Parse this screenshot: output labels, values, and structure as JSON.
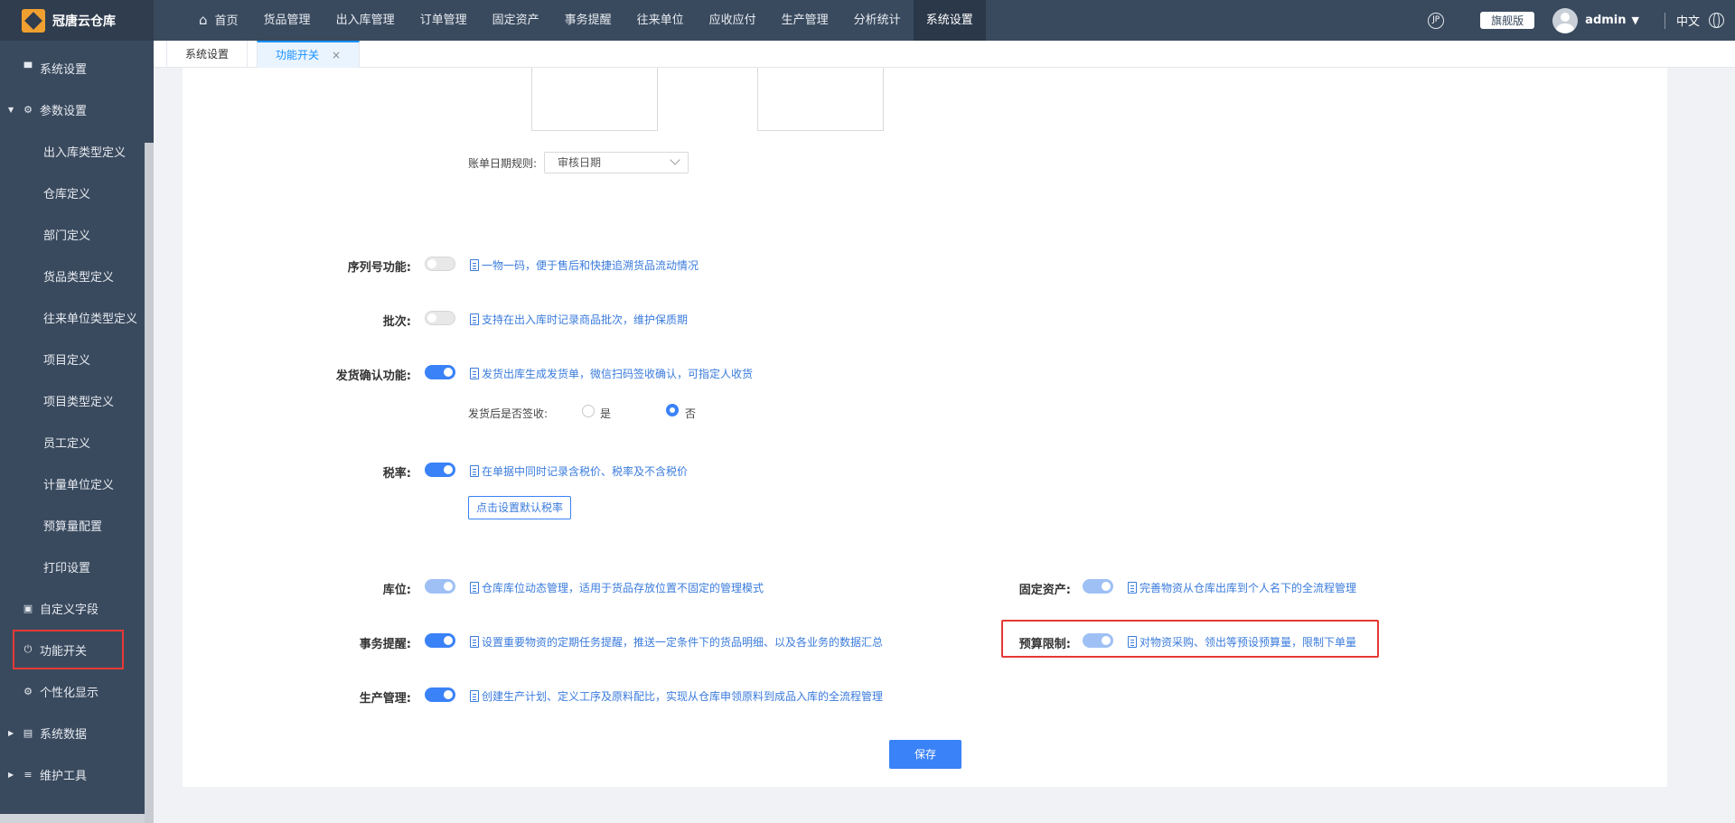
{
  "app": {
    "logo_text": "冠唐云仓库"
  },
  "nav": [
    {
      "label": "首页"
    },
    {
      "label": "货品管理"
    },
    {
      "label": "出入库管理"
    },
    {
      "label": "订单管理"
    },
    {
      "label": "固定资产"
    },
    {
      "label": "事务提醒"
    },
    {
      "label": "往来单位"
    },
    {
      "label": "应收应付"
    },
    {
      "label": "生产管理"
    },
    {
      "label": "分析统计"
    },
    {
      "label": "系统设置",
      "active": true
    }
  ],
  "topright": {
    "icon_text": "JP",
    "edition": "旗舰版",
    "user": "admin",
    "lang": "中文"
  },
  "sidebar": {
    "items": [
      {
        "label": "系统设置",
        "icon": "monitor-icon"
      },
      {
        "label": "参数设置",
        "icon": "gear-icon",
        "expanded": true
      },
      {
        "label": "出入库类型定义"
      },
      {
        "label": "仓库定义"
      },
      {
        "label": "部门定义"
      },
      {
        "label": "货品类型定义"
      },
      {
        "label": "往来单位类型定义"
      },
      {
        "label": "项目定义"
      },
      {
        "label": "项目类型定义"
      },
      {
        "label": "员工定义"
      },
      {
        "label": "计量单位定义"
      },
      {
        "label": "预算量配置"
      },
      {
        "label": "打印设置"
      },
      {
        "label": "自定义字段",
        "icon": "form-icon"
      },
      {
        "label": "功能开关",
        "icon": "power-icon",
        "selected": true
      },
      {
        "label": "个性化显示",
        "icon": "gear-icon"
      },
      {
        "label": "系统数据",
        "icon": "chart-icon"
      },
      {
        "label": "维护工具",
        "icon": "database-icon"
      }
    ]
  },
  "tabs": [
    {
      "label": "系统设置"
    },
    {
      "label": "功能开关",
      "active": true,
      "close": "×"
    }
  ],
  "bill_date": {
    "label": "账单日期规则:",
    "value": "审核日期"
  },
  "features": {
    "serial": {
      "label": "序列号功能:",
      "on": false,
      "desc": "一物一码，便于售后和快捷追溯货品流动情况"
    },
    "batch": {
      "label": "批次:",
      "on": false,
      "desc": "支持在出入库时记录商品批次，维护保质期"
    },
    "delivery": {
      "label": "发货确认功能:",
      "on": true,
      "desc": "发货出库生成发货单，微信扫码签收确认，可指定人收货"
    },
    "delivery_sign": {
      "label": "发货后是否签收:",
      "yes": "是",
      "no": "否",
      "selected": "否"
    },
    "tax": {
      "label": "税率:",
      "on": true,
      "desc": "在单据中同时记录含税价、税率及不含税价",
      "button": "点击设置默认税率"
    },
    "location": {
      "label": "库位:",
      "on": true,
      "desc": "仓库库位动态管理，适用于货品存放位置不固定的管理模式"
    },
    "fixed_asset": {
      "label": "固定资产:",
      "on": true,
      "desc": "完善物资从仓库出库到个人名下的全流程管理"
    },
    "reminder": {
      "label": "事务提醒:",
      "on": true,
      "desc": "设置重要物资的定期任务提醒，推送一定条件下的货品明细、以及各业务的数据汇总"
    },
    "budget": {
      "label": "预算限制:",
      "on": true,
      "desc": "对物资采购、领出等预设预算量，限制下单量"
    },
    "production": {
      "label": "生产管理:",
      "on": true,
      "desc": "创建生产计划、定义工序及原料配比，实现从仓库申领原料到成品入库的全流程管理"
    }
  },
  "save_label": "保存",
  "colors": {
    "accent": "#3a82f7",
    "topbar": "#3a4a5e",
    "highlight": "#e53935"
  }
}
